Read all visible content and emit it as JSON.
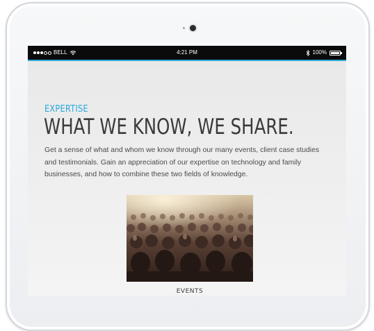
{
  "statusbar": {
    "carrier": "BELL",
    "time": "4:21 PM",
    "battery": "100%"
  },
  "page": {
    "kicker": "EXPERTISE",
    "headline": "WHAT WE KNOW, WE SHARE.",
    "body_lines": [
      "Get a sense of what and whom we know through our many events, client case studies",
      "and testimonials. Gain an appreciation of our expertise on technology and family",
      "businesses, and how to combine these two fields of knowledge."
    ],
    "image_caption": "EVENTS"
  },
  "colors": {
    "accent": "#29a8de",
    "headline": "#3a3a3a",
    "statusbar_bg": "#0b0b0b"
  },
  "icons": {
    "signal": "signal-dots-icon",
    "wifi": "wifi-icon",
    "bluetooth": "bluetooth-icon",
    "battery": "battery-icon",
    "camera": "camera-icon"
  }
}
